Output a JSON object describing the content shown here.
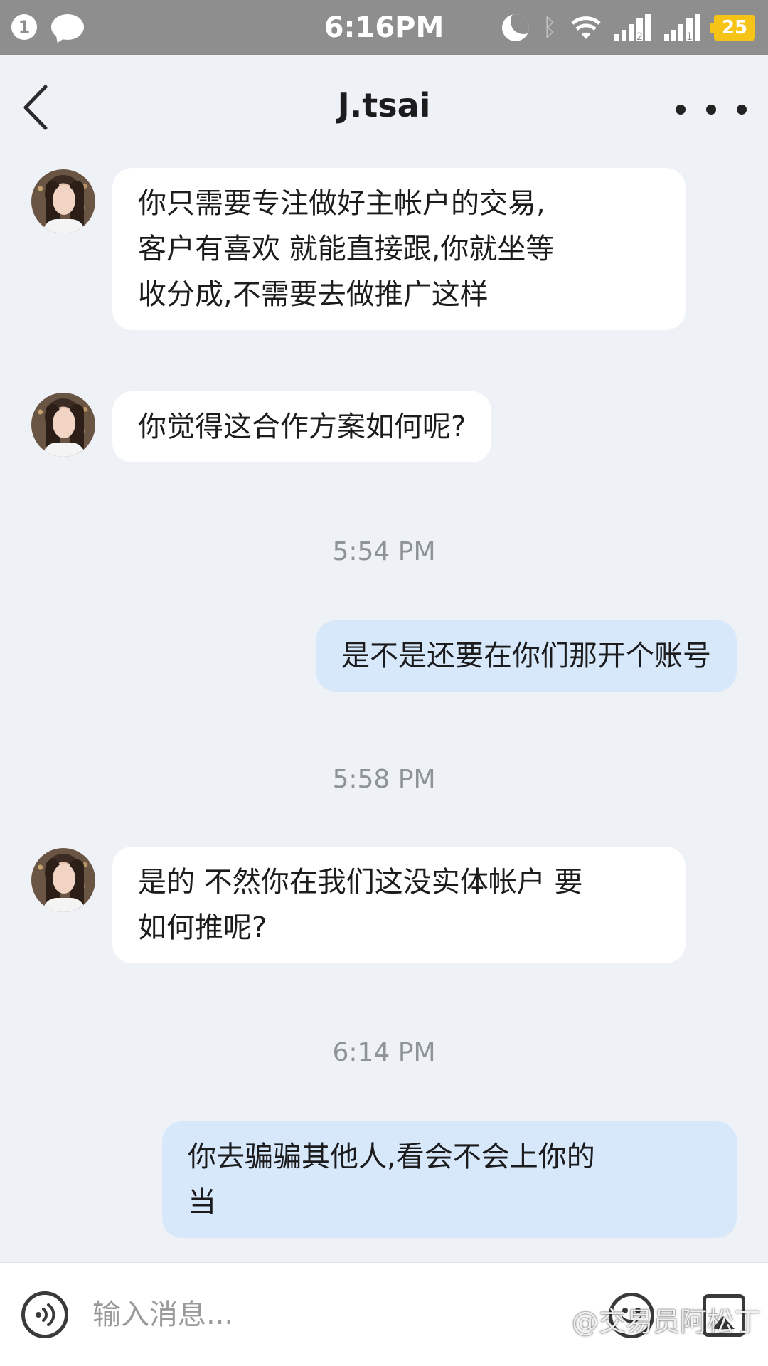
{
  "status_bar": {
    "notification_count": "1",
    "time": "6:16PM",
    "signal_1_label": "2",
    "signal_2_label": "1",
    "battery": "25"
  },
  "header": {
    "title": "J.tsai"
  },
  "messages": [
    {
      "direction": "in",
      "text": "你只需要专注做好主帐户的交易,\n客户有喜欢 就能直接跟,你就坐等\n收分成,不需要去做推广这样"
    },
    {
      "direction": "in",
      "text": "你觉得这合作方案如何呢?"
    },
    {
      "type": "timestamp",
      "text": "5:54 PM"
    },
    {
      "direction": "out",
      "text": "是不是还要在你们那开个账号"
    },
    {
      "type": "timestamp",
      "text": "5:58 PM"
    },
    {
      "direction": "in",
      "text": "是的 不然你在我们这没实体帐户 要\n如何推呢?"
    },
    {
      "type": "timestamp",
      "text": "6:14 PM"
    },
    {
      "direction": "out",
      "text": "你去骗骗其他人,看会不会上你的\n当"
    }
  ],
  "input": {
    "placeholder": "输入消息..."
  },
  "watermark": "@交易员阿松丁",
  "icons": {
    "back": "chevron-left-icon",
    "more": "more-dots-icon",
    "voice": "voice-icon",
    "emoji": "emoji-icon",
    "image": "image-icon"
  }
}
